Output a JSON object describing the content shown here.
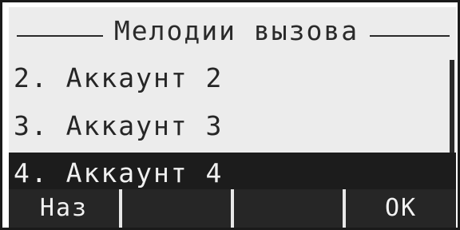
{
  "screen": {
    "title": "Мелодии вызова"
  },
  "menu": {
    "items": [
      {
        "label": "2. Аккаунт 2",
        "selected": false
      },
      {
        "label": "3. Аккаунт 3",
        "selected": false
      },
      {
        "label": "4. Аккаунт 4",
        "selected": true
      }
    ]
  },
  "softkeys": {
    "key1": "Наз",
    "key2": "",
    "key3": "",
    "key4": "OK"
  },
  "colors": {
    "lcd_background": "#ececec",
    "lcd_text": "#262626",
    "highlight_background": "#1c1c1c",
    "highlight_text": "#f0f0f0"
  },
  "icons": {
    "scrollbar": "vertical-scrollbar"
  }
}
